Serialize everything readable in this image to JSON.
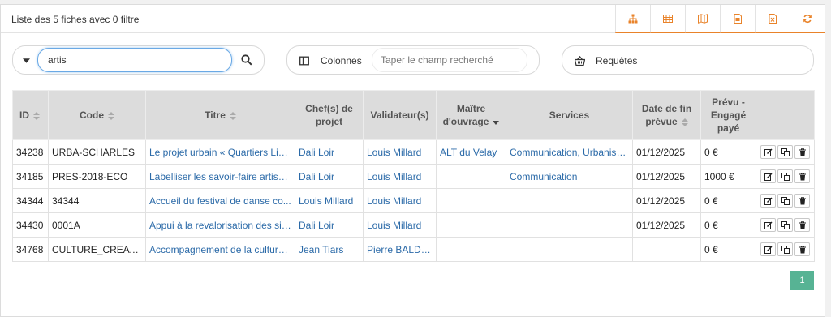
{
  "header": {
    "title": "Liste des 5 fiches avec 0 filtre",
    "toolbar": [
      "hierarchy-icon",
      "table-icon",
      "map-icon",
      "pdf-export-icon",
      "excel-export-icon",
      "refresh-icon"
    ]
  },
  "colors": {
    "accent": "#e9832a",
    "link": "#2b6aa8",
    "header_bg": "#dcdcdc",
    "pager": "#57b394"
  },
  "search": {
    "value": "artis"
  },
  "columns_control": {
    "label": "Colonnes",
    "placeholder": "Taper le champ recherché"
  },
  "requests": {
    "label": "Requêtes"
  },
  "table": {
    "headers": {
      "id": "ID",
      "code": "Code",
      "titre": "Titre",
      "chefs": "Chef(s) de projet",
      "validateurs": "Validateur(s)",
      "maitre": "Maître d'ouvrage",
      "services": "Services",
      "date": "Date de fin prévue",
      "prevu": "Prévu - Engagé payé"
    },
    "rows": [
      {
        "id": "34238",
        "code": "URBA-SCHARLES",
        "titre": "Le projet urbain « Quartiers Libr...",
        "chef": "Dali Loir",
        "validateur": "Louis Millard",
        "maitre": "ALT du Velay",
        "services": "Communication, Urbanisme",
        "date": "01/12/2025",
        "prevu": "0 €"
      },
      {
        "id": "34185",
        "code": "PRES-2018-ECO",
        "titre": "Labelliser les savoir-faire artisa...",
        "chef": "Dali Loir",
        "validateur": "Louis Millard",
        "maitre": "",
        "services": "Communication",
        "date": "01/12/2025",
        "prevu": "1000 €"
      },
      {
        "id": "34344",
        "code": "34344",
        "titre": "Accueil du festival de danse co...",
        "chef": "Louis Millard",
        "validateur": "Louis Millard",
        "maitre": "",
        "services": "",
        "date": "01/12/2025",
        "prevu": "0 €"
      },
      {
        "id": "34430",
        "code": "0001A",
        "titre": "Appui à la revalorisation des sit...",
        "chef": "Dali Loir",
        "validateur": "Louis Millard",
        "maitre": "",
        "services": "",
        "date": "01/12/2025",
        "prevu": "0 €"
      },
      {
        "id": "34768",
        "code": "CULTURE_CREATION",
        "titre": "Accompagnement de la culture...",
        "chef": "Jean Tiars",
        "validateur": "Pierre BALDON",
        "maitre": "",
        "services": "",
        "date": "",
        "prevu": "0 €"
      }
    ],
    "row_actions": [
      "edit-icon",
      "copy-icon",
      "delete-icon"
    ]
  },
  "pagination": {
    "current": "1"
  }
}
